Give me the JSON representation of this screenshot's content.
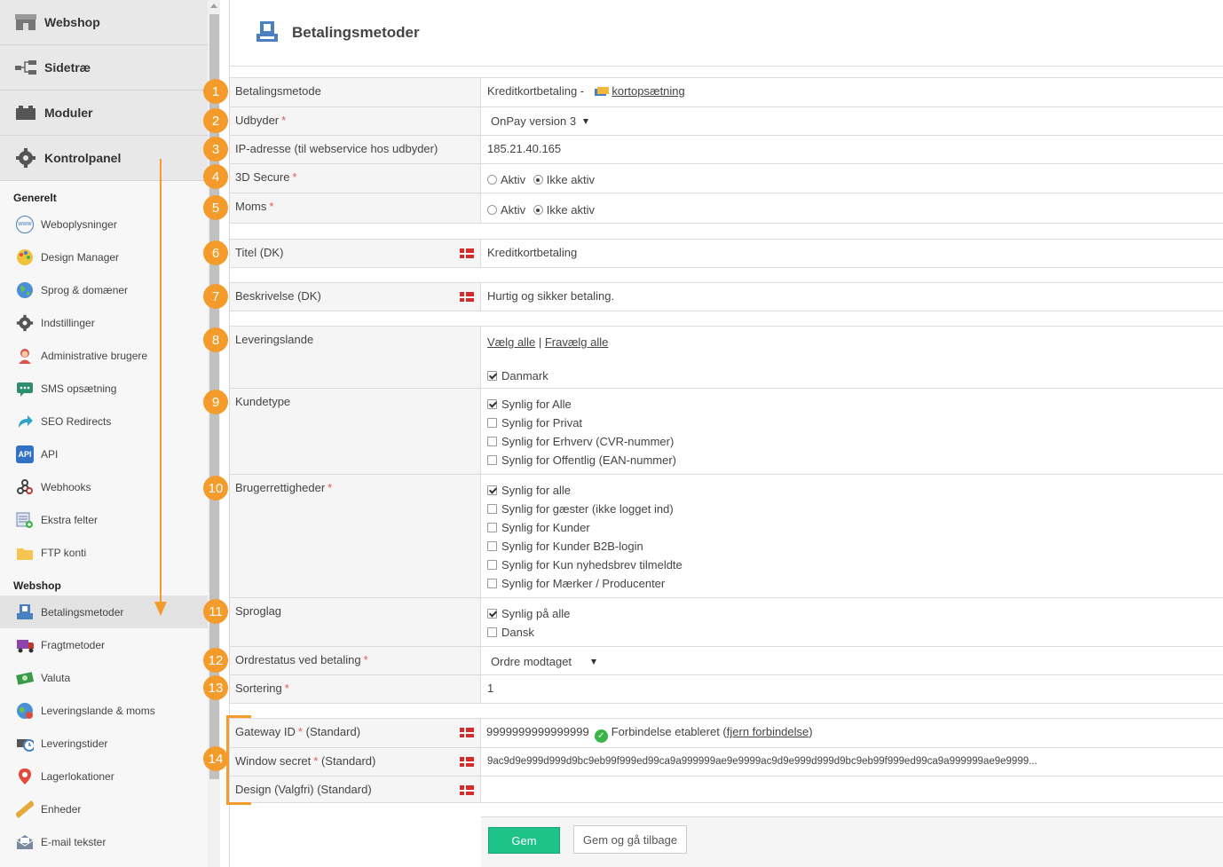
{
  "sidebar": {
    "top": [
      {
        "label": "Webshop",
        "icon": "shop-icon"
      },
      {
        "label": "Sidetræ",
        "icon": "sitemap-icon"
      },
      {
        "label": "Moduler",
        "icon": "modules-icon"
      },
      {
        "label": "Kontrolpanel",
        "icon": "gear-icon"
      }
    ],
    "section_general": "Generelt",
    "general_items": [
      "Weboplysninger",
      "Design Manager",
      "Sprog & domæner",
      "Indstillinger",
      "Administrative brugere",
      "SMS opsætning",
      "SEO Redirects",
      "API",
      "Webhooks",
      "Ekstra felter",
      "FTP konti"
    ],
    "api_icon_text": "API",
    "section_webshop": "Webshop",
    "webshop_items": [
      "Betalingsmetoder",
      "Fragtmetoder",
      "Valuta",
      "Leveringslande & moms",
      "Leveringstider",
      "Lagerlokationer",
      "Enheder",
      "E-mail tekster"
    ]
  },
  "page": {
    "title": "Betalingsmetoder"
  },
  "badges": [
    "1",
    "2",
    "3",
    "4",
    "5",
    "6",
    "7",
    "8",
    "9",
    "10",
    "11",
    "12",
    "13",
    "14"
  ],
  "form": {
    "method_label": "Betalingsmetode",
    "method_value": "Kreditkortbetaling -",
    "method_link": "kortopsætning",
    "provider_label": "Udbyder",
    "provider_value": "OnPay version 3",
    "ip_label": "IP-adresse (til webservice hos udbyder)",
    "ip_value": "185.21.40.165",
    "secure_label": "3D Secure",
    "vat_label": "Moms",
    "opt_active": "Aktiv",
    "opt_inactive": "Ikke aktiv",
    "title_label": "Titel (DK)",
    "title_value": "Kreditkortbetaling",
    "desc_label": "Beskrivelse (DK)",
    "desc_value": "Hurtig og sikker betaling.",
    "countries_label": "Leveringslande",
    "select_all": "Vælg alle",
    "sep": "|",
    "deselect_all": "Fravælg alle",
    "country_dk": "Danmark",
    "customer_label": "Kundetype",
    "customer_opts": [
      "Synlig for Alle",
      "Synlig for Privat",
      "Synlig for Erhverv (CVR-nummer)",
      "Synlig for Offentlig (EAN-nummer)"
    ],
    "rights_label": "Brugerrettigheder",
    "rights_opts": [
      "Synlig for alle",
      "Synlig for gæster (ikke logget ind)",
      "Synlig for Kunder",
      "Synlig for Kunder B2B-login",
      "Synlig for Kun nyhedsbrev tilmeldte",
      "Synlig for Mærker / Producenter"
    ],
    "lang_label": "Sproglag",
    "lang_opts": [
      "Synlig på alle",
      "Dansk"
    ],
    "status_label": "Ordrestatus ved betaling",
    "status_value": "Ordre modtaget",
    "sort_label": "Sortering",
    "sort_value": "1",
    "gateway_label": "Gateway ID",
    "std": "(Standard)",
    "gateway_value": "9999999999999999",
    "conn_text": "Forbindelse etableret (",
    "conn_link": "fjern forbindelse",
    "conn_close": ")",
    "secret_label": "Window secret",
    "secret_value": "9ac9d9e999d999d9bc9eb99f999ed99ca9a999999ae9e9999ac9d9e999d999d9bc9eb99f999ed99ca9a999999ae9e9999...",
    "design_label": "Design (Valgfri) (Standard)",
    "req": "*"
  },
  "buttons": {
    "save": "Gem",
    "save_back": "Gem og gå tilbage"
  },
  "colors": {
    "accent": "#f39c2c",
    "save": "#1ec38a"
  }
}
